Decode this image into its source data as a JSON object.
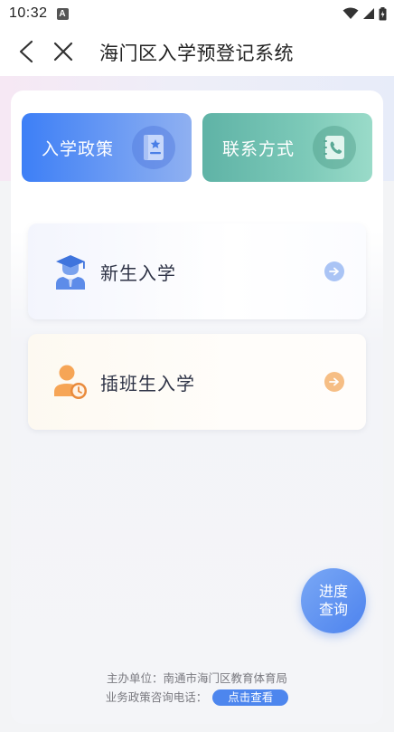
{
  "status": {
    "time": "10:32",
    "badge": "A"
  },
  "header": {
    "title": "海门区入学预登记系统"
  },
  "tiles": [
    {
      "label": "入学政策"
    },
    {
      "label": "联系方式"
    }
  ],
  "entries": [
    {
      "label": "新生入学"
    },
    {
      "label": "插班生入学"
    }
  ],
  "fab": {
    "line1": "进度",
    "line2": "查询"
  },
  "footer": {
    "organizer": "主办单位：南通市海门区教育体育局",
    "hotline_label": "业务政策咨询电话：",
    "view_button": "点击查看"
  },
  "colors": {
    "primary": "#4d86ee",
    "policy_tile": "#3d7ff6",
    "contact_tile": "#5fb3a6",
    "transfer_accent": "#f6be85"
  }
}
